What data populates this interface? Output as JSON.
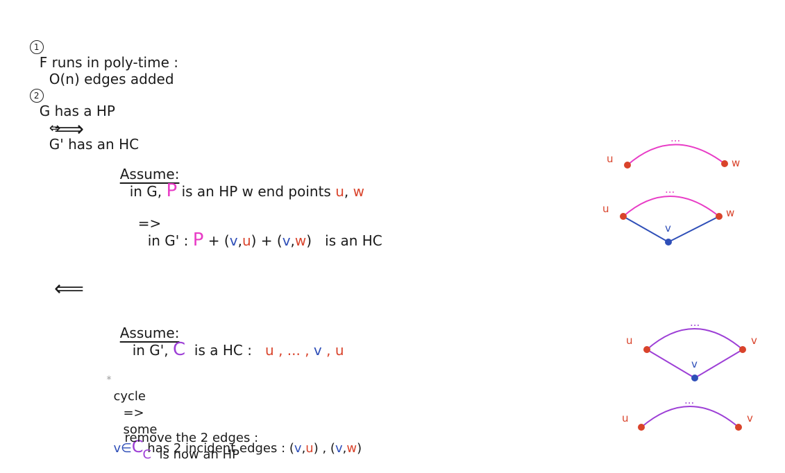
{
  "step1": {
    "num": "1",
    "text": "F runs in poly-time :",
    "bound": "O(n) edges added"
  },
  "step2": {
    "num": "2",
    "left": "G has a HP",
    "iff": "⇔",
    "right": "G' has an HC"
  },
  "forward": {
    "arrow": "⟹",
    "assume_label": "Assume:",
    "assume_a": "in G, ",
    "assume_p": "P",
    "assume_b": " is an HP w end points ",
    "assume_u": "u",
    "assume_c": ", ",
    "assume_w": "w",
    "then_arrow": "=>",
    "then_a": "in G' : ",
    "then_p": "P",
    "then_b": " + (",
    "then_v1": "v",
    "then_c1": ",",
    "then_u": "u",
    "then_d": ") + (",
    "then_v2": "v",
    "then_c2": ",",
    "then_w": "w",
    "then_e": ")   is an HC"
  },
  "backward": {
    "arrow": "⟸",
    "assume_label": "Assume:",
    "assume_a": "in G', ",
    "assume_c": "C",
    "assume_b": "  is a HC :   ",
    "assume_seq": "u , ... ,",
    "assume_v": " v",
    "assume_end": " , u",
    "star": "*",
    "cycle": "cycle",
    "implies": "=>",
    "some": "some",
    "vin": "v∈",
    "vin_c": "C",
    "has": " has 2 incident edges : (",
    "e_v1": "v",
    "e_c1": ",",
    "e_u": "u",
    "e_mid": ") , (",
    "e_v2": "v",
    "e_c2": ",",
    "e_w": "w",
    "e_end": ")",
    "remove": "remove the 2 edges :",
    "remove_c": "C",
    "remove_end": "  is now an HP"
  },
  "diagrams": {
    "d1": {
      "left": "u",
      "right": "w",
      "dots": "..."
    },
    "d2": {
      "left": "u",
      "right": "w",
      "mid": "v",
      "dots": "..."
    },
    "d3": {
      "left": "u",
      "right": "v",
      "mid": "v",
      "dots": "..."
    },
    "d4": {
      "left": "u",
      "right": "v",
      "dots": "..."
    }
  },
  "colors": {
    "pink": "#e83cc6",
    "red": "#d9432b",
    "blue": "#2f4fb8",
    "purple": "#9d3fd6"
  }
}
